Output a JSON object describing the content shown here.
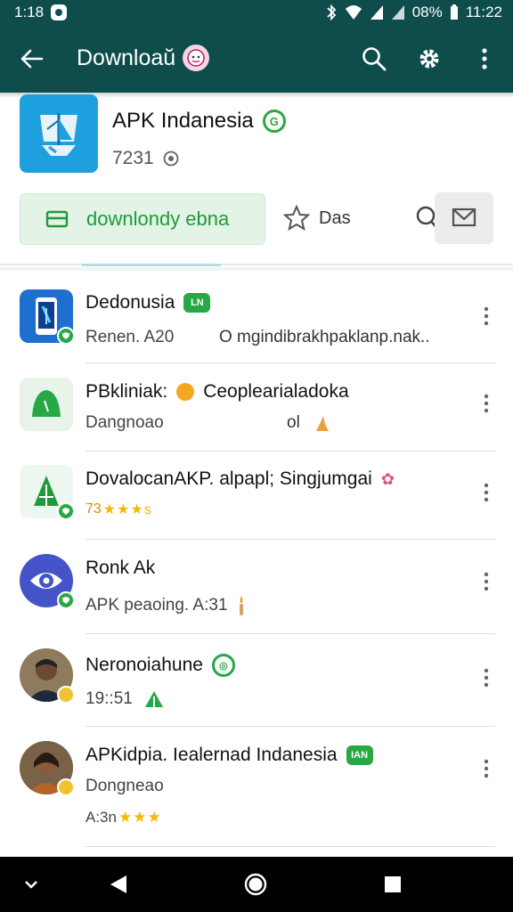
{
  "status": {
    "time_left": "1:18",
    "battery": "08%",
    "time_right": "11:22"
  },
  "appbar": {
    "title": "Downloaŭ"
  },
  "app": {
    "name": "APK Indanesia",
    "id": "7231",
    "badge": "G"
  },
  "actions": {
    "download_label": "downlondy ebna",
    "favorite_label": "Das"
  },
  "list": [
    {
      "title": "Dedonusia",
      "chip": "LN",
      "sub": "Renen. A20",
      "extra": "O mgindibrakhpaklanp.nak..",
      "avatar": "phone"
    },
    {
      "title": "PBkliniak:",
      "title2": "Ceoplearialadoka",
      "sub": "Dangnoao",
      "extra": "ol",
      "avatar": "bell"
    },
    {
      "title": "DovalocanAKP. alpapl; Singjumgai",
      "sub": "73",
      "stars": "★★★s",
      "avatar": "tree"
    },
    {
      "title": "Ronk Ak",
      "sub": "APK peaoing. A:31",
      "avatar": "eye"
    },
    {
      "title": "Neronoiahune",
      "sub": "19::51",
      "avatar": "person1"
    },
    {
      "title": "APKidpia. Iealernad Indanesia",
      "chip": "IAN",
      "sub": "Dongneao",
      "sub2": "A:3n",
      "stars": "★★★",
      "avatar": "person2"
    }
  ],
  "colors": {
    "primary": "#0f4d4d",
    "green": "#27a844",
    "app_icon": "#1fa0de"
  }
}
